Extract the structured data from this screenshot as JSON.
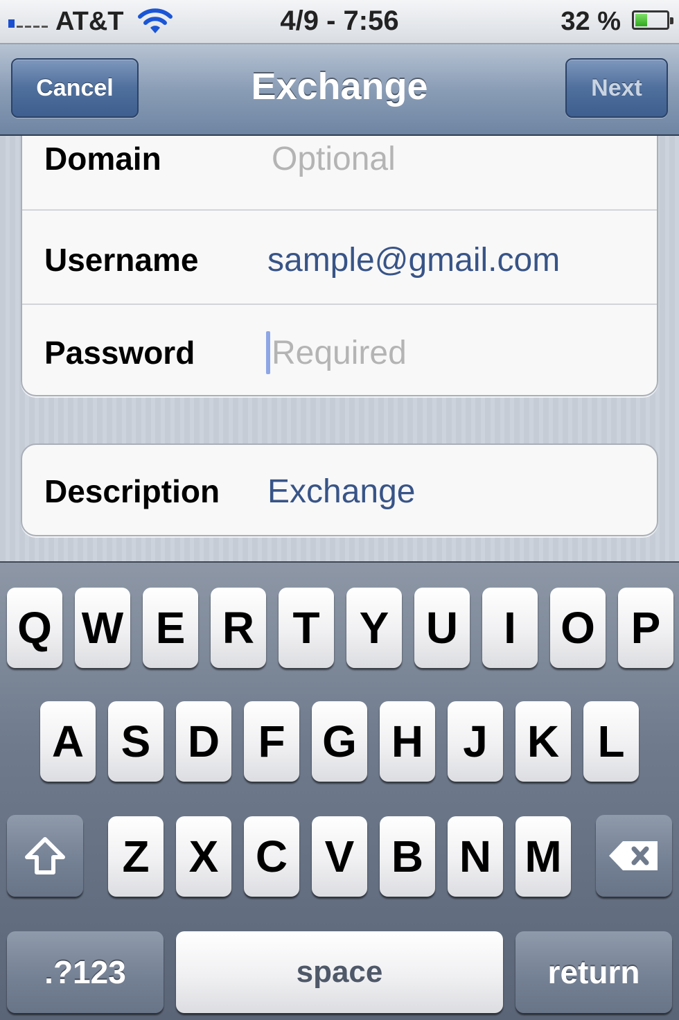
{
  "status_bar": {
    "carrier": "AT&T",
    "time": "4/9 - 7:56",
    "battery_percent": "32 %",
    "battery_level": 0.32
  },
  "nav": {
    "cancel_label": "Cancel",
    "title": "Exchange",
    "next_label": "Next"
  },
  "form": {
    "domain": {
      "label": "Domain",
      "placeholder": "Optional"
    },
    "username": {
      "label": "Username",
      "value": "sample@gmail.com"
    },
    "password": {
      "label": "Password",
      "placeholder": "Required"
    },
    "description": {
      "label": "Description",
      "value": "Exchange"
    }
  },
  "keyboard": {
    "row1": [
      "Q",
      "W",
      "E",
      "R",
      "T",
      "Y",
      "U",
      "I",
      "O",
      "P"
    ],
    "row2": [
      "A",
      "S",
      "D",
      "F",
      "G",
      "H",
      "J",
      "K",
      "L"
    ],
    "row3": [
      "Z",
      "X",
      "C",
      "V",
      "B",
      "N",
      "M"
    ],
    "numbers_label": ".?123",
    "space_label": "space",
    "return_label": "return",
    "shift_icon": "shift-arrow-icon",
    "delete_icon": "backspace-icon"
  },
  "colors": {
    "nav_button": "#4f6f9c",
    "field_value": "#385487",
    "placeholder": "#b4b4b4",
    "cursor": "#8ea6e6"
  }
}
